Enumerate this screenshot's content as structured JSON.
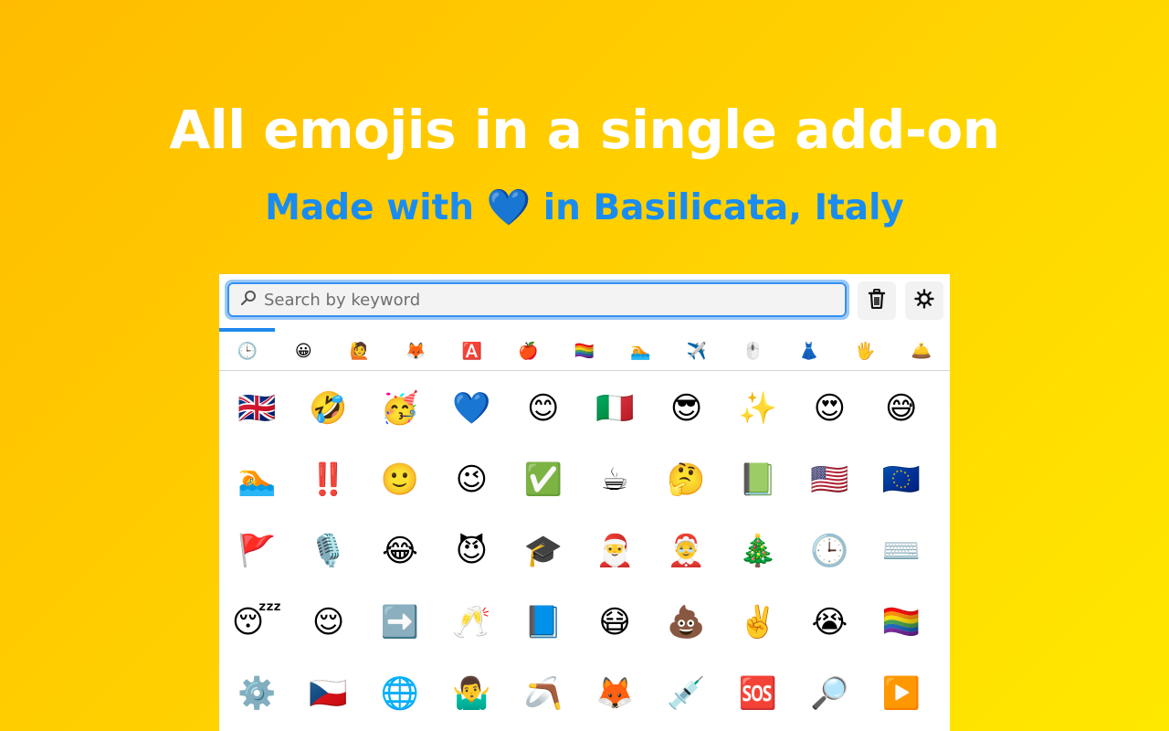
{
  "hero": {
    "title": "All emojis in a single add-on",
    "subtitle_before": "Made with ",
    "subtitle_heart": "💙",
    "subtitle_after": " in Basilicata, Italy"
  },
  "colors": {
    "background_start": "#FFBC00",
    "background_end": "#FFE800",
    "subtitle": "#1A8CF0",
    "accent": "#1F88EC"
  },
  "toolbar": {
    "search_placeholder": "Search by keyword",
    "search_value": "",
    "search_icon": "🔍",
    "clear_recent_icon": "trash-icon",
    "settings_icon": "gear-icon"
  },
  "categories": [
    {
      "name": "recent",
      "icon": "🕒",
      "active": true
    },
    {
      "name": "smileys",
      "icon": "😀"
    },
    {
      "name": "people",
      "icon": "🙋"
    },
    {
      "name": "animals",
      "icon": "🦊"
    },
    {
      "name": "symbols",
      "icon": "🅰️"
    },
    {
      "name": "food",
      "icon": "🍎"
    },
    {
      "name": "flags",
      "icon": "🏳️‍🌈"
    },
    {
      "name": "activities",
      "icon": "🏊"
    },
    {
      "name": "travel",
      "icon": "✈️"
    },
    {
      "name": "objects",
      "icon": "🖱️"
    },
    {
      "name": "clothing",
      "icon": "👗"
    },
    {
      "name": "hands",
      "icon": "🖐️"
    },
    {
      "name": "services",
      "icon": "🛎️"
    }
  ],
  "emojis": [
    "🇬🇧",
    "🤣",
    "🥳",
    "💙",
    "😊",
    "🇮🇹",
    "😎",
    "✨",
    "😍",
    "😅",
    "🏊",
    "‼️",
    "🙂",
    "😉",
    "✅",
    "☕",
    "🤔",
    "📗",
    "🇺🇸",
    "🇪🇺",
    "🚩",
    "🎙️",
    "😂",
    "😈",
    "🎓",
    "🎅",
    "🤶",
    "🎄",
    "🕒",
    "⌨️",
    "😴",
    "😌",
    "➡️",
    "🥂",
    "📘",
    "😷",
    "💩",
    "✌️",
    "😭",
    "🏳️‍🌈",
    "⚙️",
    "🇨🇿",
    "🌐",
    "🤷‍♂️",
    "🪃",
    "🦊",
    "💉",
    "🆘",
    "🔎",
    "▶️"
  ]
}
